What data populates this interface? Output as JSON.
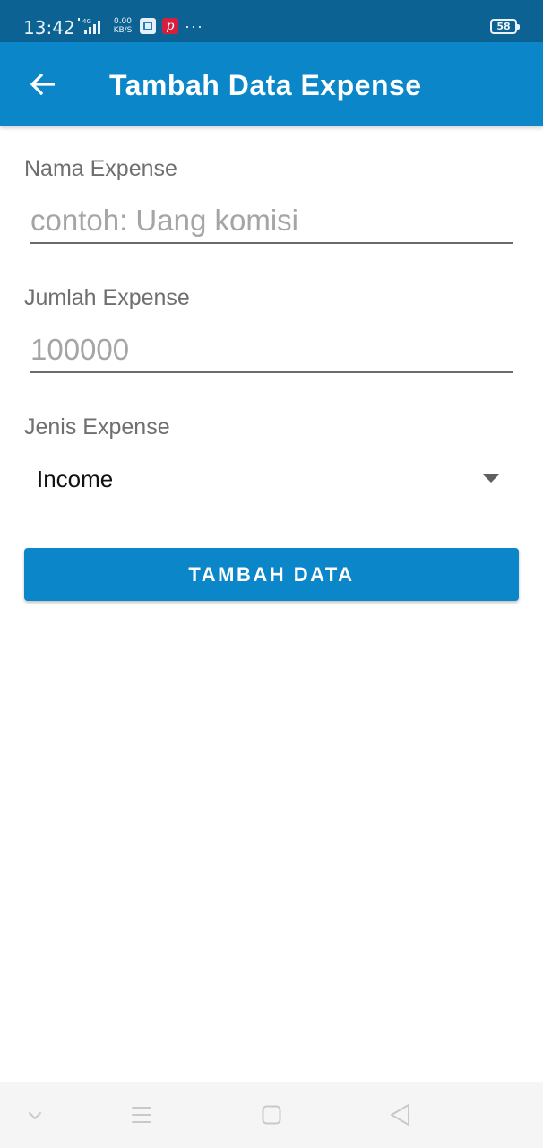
{
  "status_bar": {
    "time": "13:42",
    "network_type": "4G",
    "data_rate_value": "0.00",
    "data_rate_unit": "KB/S",
    "pinterest_glyph": "p",
    "more_indicator": "···",
    "battery_level": "58",
    "icons": [
      "signal-icon",
      "notification-app-icon",
      "pinterest-icon",
      "battery-icon"
    ]
  },
  "app_bar": {
    "title": "Tambah Data Expense",
    "back_icon": "arrow-left-icon",
    "color": "#0b86c8"
  },
  "form": {
    "name_field": {
      "label": "Nama Expense",
      "value": "",
      "placeholder": "contoh: Uang komisi"
    },
    "amount_field": {
      "label": "Jumlah Expense",
      "value": "",
      "placeholder": "100000"
    },
    "type_field": {
      "label": "Jenis Expense",
      "selected": "Income",
      "icon": "dropdown-triangle-icon"
    },
    "submit_label": "TAMBAH DATA"
  },
  "nav_bar": {
    "icons": [
      "chevron-down-icon",
      "menu-icon",
      "home-square-icon",
      "back-triangle-icon"
    ]
  },
  "colors": {
    "status_bar": "#0b6293",
    "primary": "#0b86c8",
    "label_text": "#6f6f6f",
    "placeholder_text": "#a5a5a5"
  }
}
